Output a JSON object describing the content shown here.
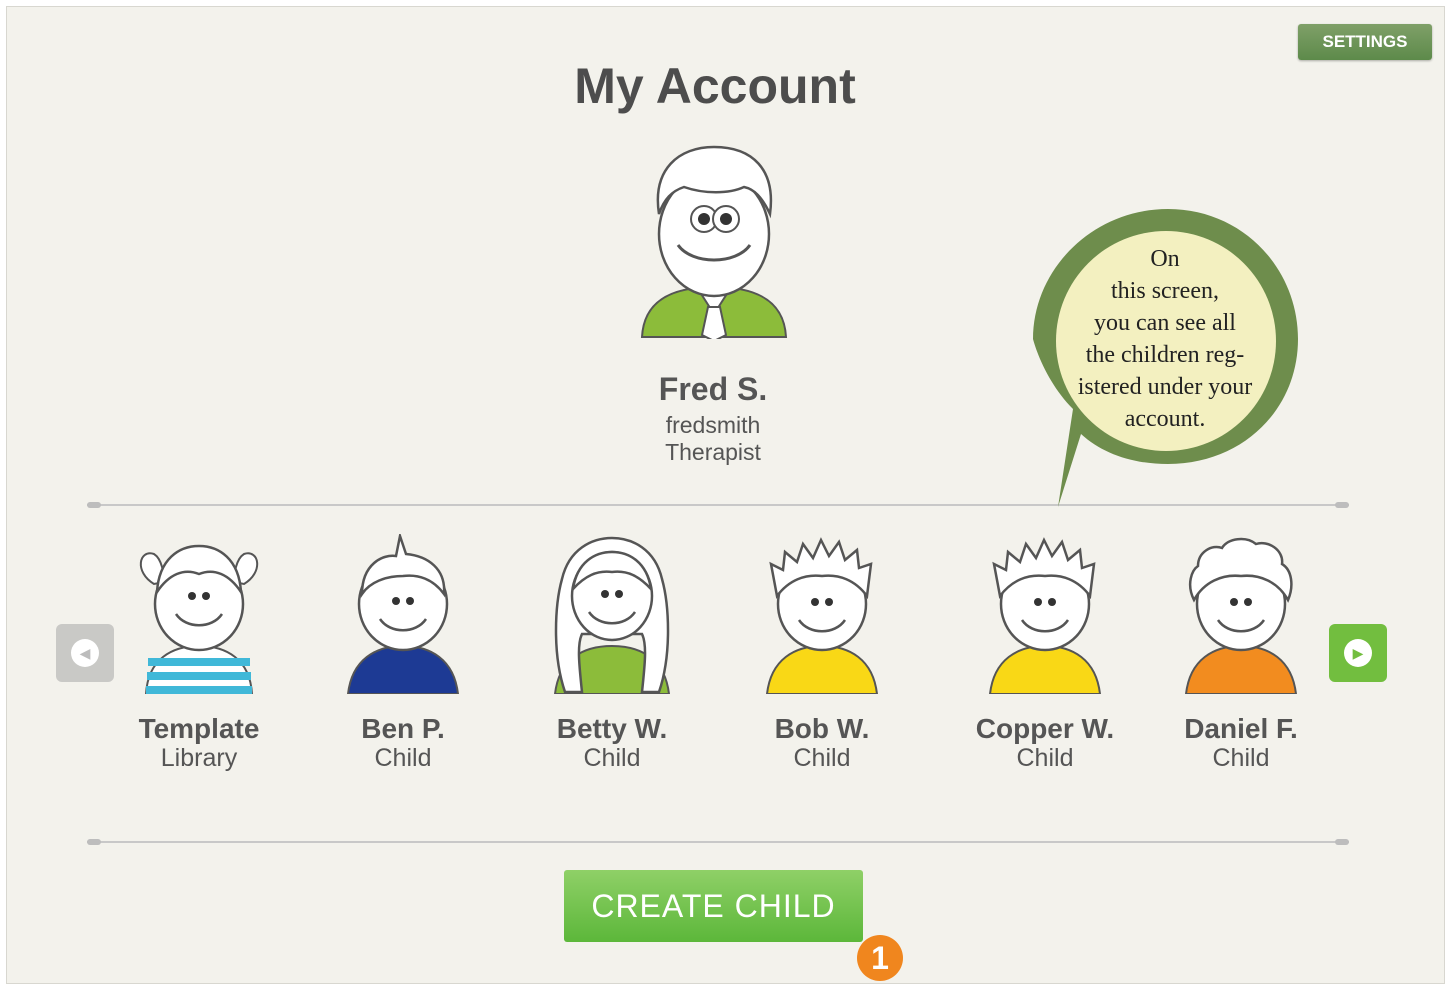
{
  "header": {
    "title": "My Account",
    "settings_label": "SETTINGS"
  },
  "profile": {
    "name": "Fred S.",
    "username": "fredsmith",
    "role": "Therapist"
  },
  "callout": {
    "lines": [
      "On",
      "this screen,",
      "you can see all",
      "the children reg-",
      "istered under your",
      "account."
    ]
  },
  "carousel": {
    "items": [
      {
        "name": "Template",
        "role": "Library",
        "avatar": "girl-pigtails-striped-avatar",
        "shirt": "#40b8d8"
      },
      {
        "name": "Ben P.",
        "role": "Child",
        "avatar": "boy-tuft-avatar",
        "shirt": "#1d3a94"
      },
      {
        "name": "Betty W.",
        "role": "Child",
        "avatar": "girl-curly-hair-avatar",
        "shirt": "#8cbc3a"
      },
      {
        "name": "Bob W.",
        "role": "Child",
        "avatar": "boy-spiky-hair-avatar",
        "shirt": "#f9d816"
      },
      {
        "name": "Copper W.",
        "role": "Child",
        "avatar": "boy-spiky-hair-avatar",
        "shirt": "#f9d816"
      },
      {
        "name": "Daniel F.",
        "role": "Child",
        "avatar": "boy-curly-hair-avatar",
        "shirt": "#f28c1f"
      }
    ],
    "prev_icon": "chevron-left-icon",
    "next_icon": "chevron-right-icon"
  },
  "actions": {
    "create_child_label": "CREATE CHILD"
  },
  "step_marker": "1",
  "colors": {
    "accent_green": "#5cb73a",
    "settings_green": "#6b9255",
    "callout_green": "#6e8d4c",
    "callout_fill": "#f3f0c0",
    "step_orange": "#f0861e"
  }
}
